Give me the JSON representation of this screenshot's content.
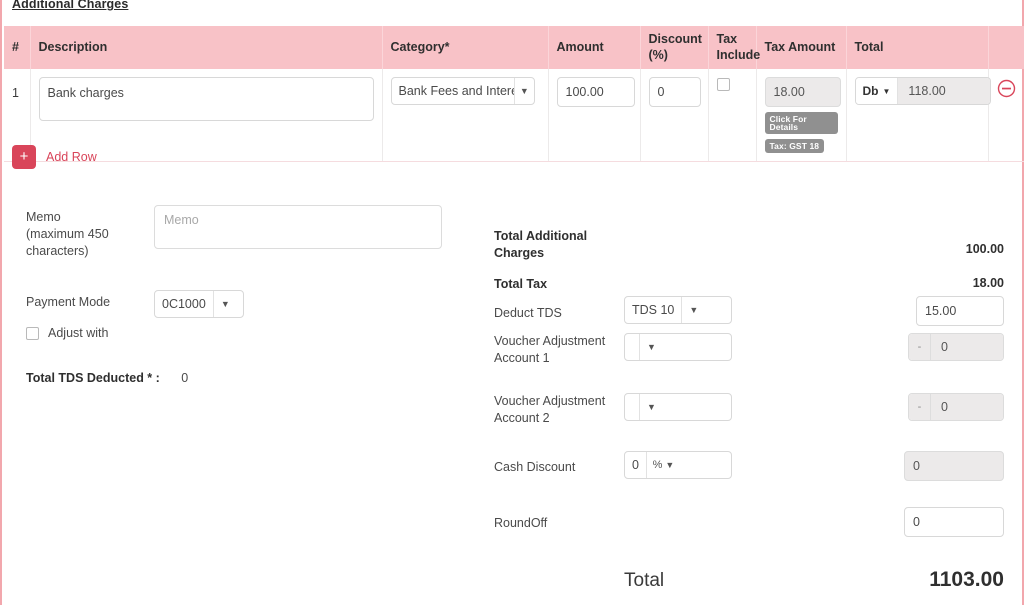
{
  "section": {
    "title": "Additional Charges"
  },
  "table": {
    "headers": [
      "#",
      "Description",
      "Category*",
      "Amount",
      "Discount (%)",
      "Tax Include",
      "Tax Amount",
      "Total",
      ""
    ],
    "rows": [
      {
        "index": "1",
        "description": "Bank charges",
        "category": "Bank Fees and Interests",
        "amount": "100.00",
        "discount": "0",
        "tax_include": false,
        "tax_amount": "18.00",
        "tax_details_badge": "Click For Details",
        "tax_badge": "Tax: GST 18",
        "total_prefix": "Db",
        "total": "118.00",
        "remove_icon": "circle-minus-icon"
      }
    ]
  },
  "add_row": {
    "label": "Add Row",
    "icon": "plus-icon"
  },
  "left_form": {
    "memo_label": "Memo (maximum 450 characters)",
    "memo_label_line1": "Memo",
    "memo_label_line2": "(maximum 450",
    "memo_label_line3": "characters)",
    "memo_placeholder": "Memo",
    "memo_value": "",
    "payment_mode_label": "Payment Mode",
    "payment_mode_value": "0C1000",
    "adjust_with_label": "Adjust with",
    "adjust_with_checked": false,
    "total_tds_label": "Total TDS Deducted * :",
    "total_tds_value": "0"
  },
  "summary": {
    "total_additional_charges_label_1": "Total Additional",
    "total_additional_charges_label_2": "Charges",
    "total_additional_charges_value": "100.00",
    "total_tax_label": "Total Tax",
    "total_tax_value": "18.00",
    "deduct_tds_label": "Deduct TDS",
    "deduct_tds_select": "TDS 10",
    "deduct_tds_value": "15.00",
    "voucher_adj_1_label_1": "Voucher Adjustment",
    "voucher_adj_1_label_2": "Account 1",
    "voucher_adj_1_select": "",
    "voucher_adj_1_dash": "-",
    "voucher_adj_1_value": "0",
    "voucher_adj_2_label_1": "Voucher Adjustment",
    "voucher_adj_2_label_2": "Account 2",
    "voucher_adj_2_select": "",
    "voucher_adj_2_dash": "-",
    "voucher_adj_2_value": "0",
    "cash_discount_label": "Cash Discount",
    "cash_discount_input": "0",
    "cash_discount_unit": "%",
    "cash_discount_value": "0",
    "roundoff_label": "RoundOff",
    "roundoff_value": "0",
    "grand_total_label": "Total",
    "grand_total_value": "1103.00"
  },
  "colors": {
    "header_pink": "#f8c2c7",
    "accent_red": "#d9455a",
    "badge_gray": "#909090",
    "border_pink": "#f2a7ad"
  }
}
